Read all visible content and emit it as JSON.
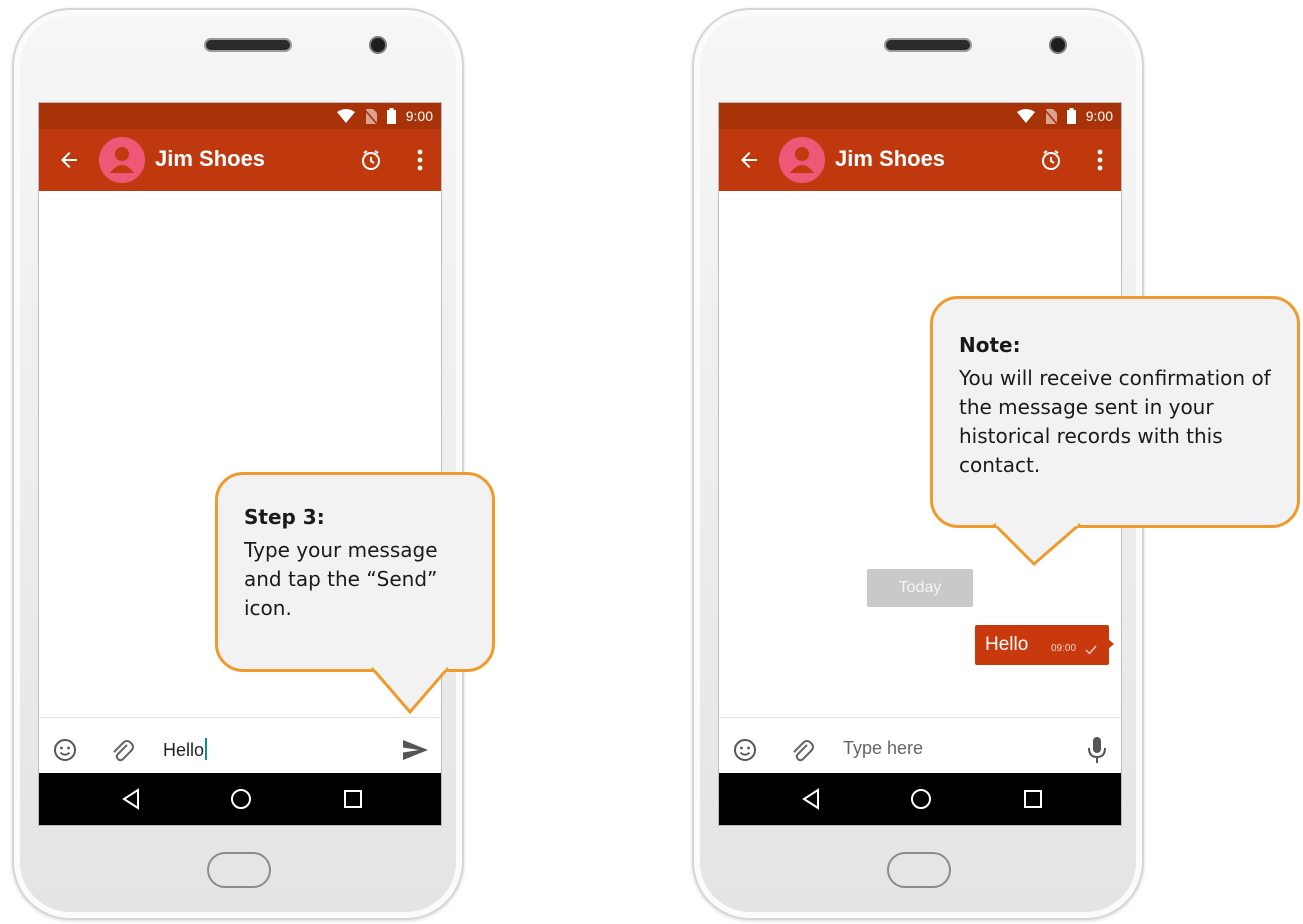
{
  "left_phone": {
    "status": {
      "time": "9:00"
    },
    "header": {
      "contact_name": "Jim Shoes"
    },
    "input": {
      "value": "Hello"
    },
    "callout": {
      "title": "Step 3:",
      "body": "Type your message and tap the “Send” icon."
    }
  },
  "right_phone": {
    "status": {
      "time": "9:00"
    },
    "header": {
      "contact_name": "Jim Shoes"
    },
    "date_separator": "Today",
    "message": {
      "text": "Hello",
      "time": "09:00",
      "status_icon": "check-icon"
    },
    "input": {
      "placeholder": "Type here"
    },
    "callout": {
      "title": "Note:",
      "body": "You will receive confirmation of the message sent in your historical records with this contact."
    }
  },
  "colors": {
    "status_bar": "#a93309",
    "app_bar": "#c0390e",
    "avatar": "#ef5777",
    "callout_border": "#ef9a2c",
    "bubble": "#c8390d"
  },
  "icons": [
    "wifi-icon",
    "no-sim-icon",
    "battery-icon",
    "back-arrow-icon",
    "avatar-icon",
    "timer-icon",
    "more-vert-icon",
    "emoji-icon",
    "attach-icon",
    "send-icon",
    "mic-icon",
    "nav-back-icon",
    "nav-home-icon",
    "nav-recents-icon"
  ]
}
